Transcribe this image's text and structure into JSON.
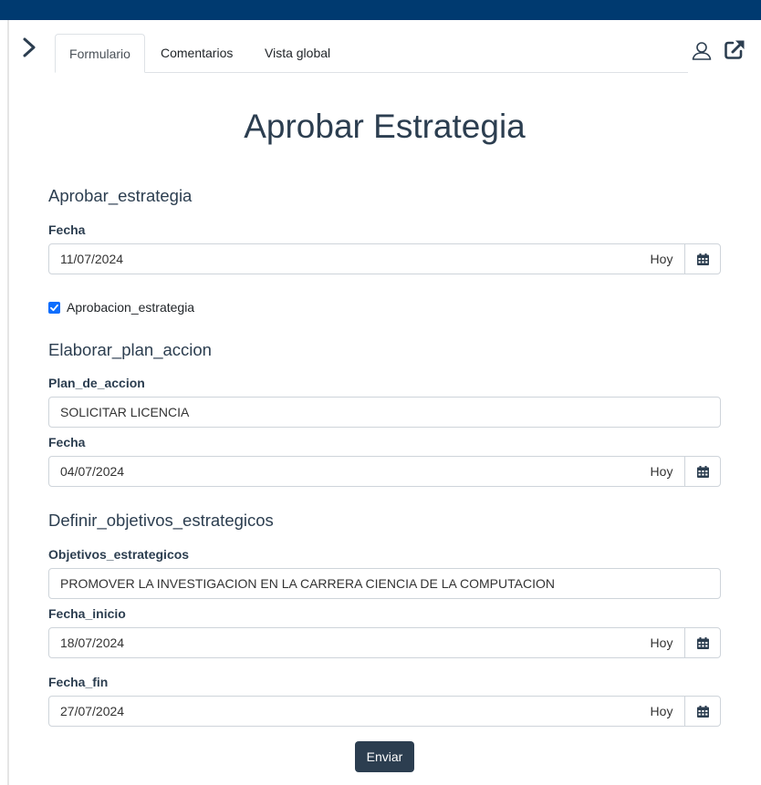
{
  "tabs": {
    "formulario": "Formulario",
    "comentarios": "Comentarios",
    "vista_global": "Vista global"
  },
  "icons": {
    "toggle": "chevron-right-icon",
    "user": "user-icon",
    "external": "external-link-icon",
    "calendar": "calendar-icon"
  },
  "colors": {
    "topbar": "#003a70",
    "primary_text": "#2c3e50",
    "submit_bg": "#2c3e50",
    "checkbox": "#0d6efd"
  },
  "form": {
    "title": "Aprobar Estrategia",
    "section1": {
      "heading": "Aprobar_estrategia",
      "fecha_label": "Fecha",
      "fecha_value": "11/07/2024",
      "hoy": "Hoy",
      "checkbox_label": "Aprobacion_estrategia",
      "checkbox_checked": true
    },
    "section2": {
      "heading": "Elaborar_plan_accion",
      "plan_label": "Plan_de_accion",
      "plan_value": "SOLICITAR LICENCIA",
      "fecha_label": "Fecha",
      "fecha_value": "04/07/2024",
      "hoy": "Hoy"
    },
    "section3": {
      "heading": "Definir_objetivos_estrategicos",
      "objetivos_label": "Objetivos_estrategicos",
      "objetivos_value": "PROMOVER LA INVESTIGACION EN LA CARRERA CIENCIA DE LA COMPUTACION",
      "inicio_label": "Fecha_inicio",
      "inicio_value": "18/07/2024",
      "fin_label": "Fecha_fin",
      "fin_value": "27/07/2024",
      "hoy": "Hoy"
    },
    "submit_label": "Enviar"
  }
}
